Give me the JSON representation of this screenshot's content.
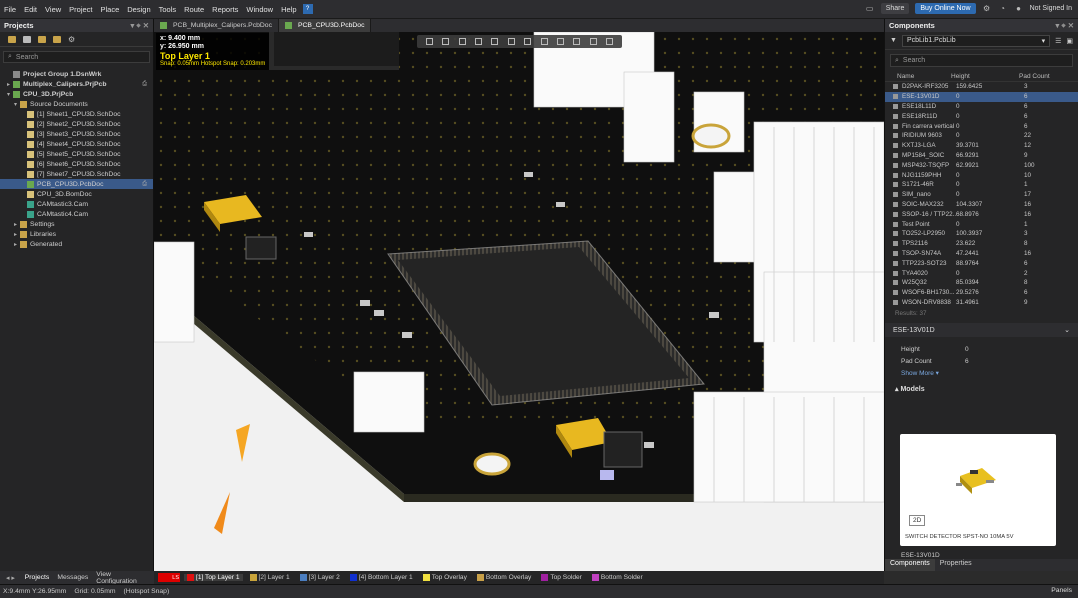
{
  "menu": [
    "File",
    "Edit",
    "View",
    "Project",
    "Place",
    "Design",
    "Tools",
    "Route",
    "Reports",
    "Window",
    "Help"
  ],
  "header": {
    "share": "Share",
    "buy": "Buy Online Now",
    "signin": "Not Signed In"
  },
  "projects": {
    "title": "Projects",
    "search_placeholder": "Search",
    "tree": [
      {
        "label": "Project Group 1.DsnWrk",
        "indent": 1,
        "icon": "grp",
        "bold": true,
        "caret": ""
      },
      {
        "label": "Multiplex_Calipers.PrjPcb",
        "indent": 1,
        "icon": "pcb",
        "bold": true,
        "caret": "▸",
        "badge": "⎙"
      },
      {
        "label": "CPU_3D.PrjPcb",
        "indent": 1,
        "icon": "pcb",
        "bold": true,
        "caret": "▾",
        "selrow": false
      },
      {
        "label": "Source Documents",
        "indent": 2,
        "icon": "folder",
        "caret": "▾"
      },
      {
        "label": "[1] Sheet1_CPU3D.SchDoc",
        "indent": 3,
        "icon": "sch"
      },
      {
        "label": "[2] Sheet2_CPU3D.SchDoc",
        "indent": 3,
        "icon": "sch"
      },
      {
        "label": "[3] Sheet3_CPU3D.SchDoc",
        "indent": 3,
        "icon": "sch"
      },
      {
        "label": "[4] Sheet4_CPU3D.SchDoc",
        "indent": 3,
        "icon": "sch"
      },
      {
        "label": "[5] Sheet5_CPU3D.SchDoc",
        "indent": 3,
        "icon": "sch"
      },
      {
        "label": "[6] Sheet6_CPU3D.SchDoc",
        "indent": 3,
        "icon": "sch"
      },
      {
        "label": "[7] Sheet7_CPU3D.SchDoc",
        "indent": 3,
        "icon": "sch"
      },
      {
        "label": "PCB_CPU3D.PcbDoc",
        "indent": 3,
        "icon": "pcb",
        "sel": true,
        "badge": "⎙"
      },
      {
        "label": "CPU_3D.BomDoc",
        "indent": 3,
        "icon": "sch"
      },
      {
        "label": "CAMtastic3.Cam",
        "indent": 3,
        "icon": "cam"
      },
      {
        "label": "CAMtastic4.Cam",
        "indent": 3,
        "icon": "cam"
      },
      {
        "label": "Settings",
        "indent": 2,
        "icon": "folder",
        "caret": "▸"
      },
      {
        "label": "Libraries",
        "indent": 2,
        "icon": "folder",
        "caret": "▸"
      },
      {
        "label": "Generated",
        "indent": 2,
        "icon": "folder",
        "caret": "▸"
      }
    ]
  },
  "tabs": [
    {
      "label": "PCB_Multiplex_Calipers.PcbDoc",
      "active": false
    },
    {
      "label": "PCB_CPU3D.PcbDoc",
      "active": true
    }
  ],
  "viewport": {
    "x": "x:  9.400  mm",
    "y": "y: 26.950  mm",
    "layer": "Top Layer 1",
    "snap": "Snap: 0.05mm Hotspot Snap: 0.203mm"
  },
  "components": {
    "title": "Components",
    "library": "PcbLib1.PcbLib",
    "search_placeholder": "Search",
    "columns": [
      "Name",
      "Height",
      "Pad Count"
    ],
    "rows": [
      [
        "D2PAK-IRF3205",
        "159.6425",
        "3"
      ],
      [
        "ESE-13V01D",
        "0",
        "6"
      ],
      [
        "ESE18L11D",
        "0",
        "6"
      ],
      [
        "ESE18R11D",
        "0",
        "6"
      ],
      [
        "Fin carrera vertical",
        "0",
        "6"
      ],
      [
        "IRIDIUM 9603",
        "0",
        "22"
      ],
      [
        "KXTJ3-LGA",
        "39.3701",
        "12"
      ],
      [
        "MP1584_SOIC",
        "66.9291",
        "9"
      ],
      [
        "MSP432-TSQFP",
        "62.9921",
        "100"
      ],
      [
        "NJG1159PHH",
        "0",
        "10"
      ],
      [
        "S1721-46R",
        "0",
        "1"
      ],
      [
        "SIM_nano",
        "0",
        "17"
      ],
      [
        "SOIC-MAX232",
        "104.3307",
        "16"
      ],
      [
        "SSOP-16 / TTP22...",
        "68.8976",
        "16"
      ],
      [
        "Test Point",
        "0",
        "1"
      ],
      [
        "TO252-LP2950",
        "100.3937",
        "3"
      ],
      [
        "TPS2116",
        "23.622",
        "8"
      ],
      [
        "TSOP-SN74A",
        "47.2441",
        "16"
      ],
      [
        "TTP223-SOT23",
        "88.9764",
        "6"
      ],
      [
        "TYA4020",
        "0",
        "2"
      ],
      [
        "W25Q32",
        "85.0394",
        "8"
      ],
      [
        "WSOF6-BH1730...",
        "29.5276",
        "6"
      ],
      [
        "WSON-DRV8838",
        "31.4961",
        "9"
      ]
    ],
    "selected_index": 1,
    "results": "Results: 37",
    "detail_title": "ESE-13V01D",
    "props": [
      [
        "Height",
        "0"
      ],
      [
        "Pad Count",
        "6"
      ]
    ],
    "show_more": "Show More ▾",
    "models_label": "Models",
    "model_2d": "2D",
    "model_desc": "SWITCH DETECTOR SPST-NO 10MA 5V",
    "selected_name": "ESE-13V01D",
    "bottom_tabs": [
      "Components",
      "Properties"
    ]
  },
  "bottom_left_tabs": [
    "Projects",
    "Messages",
    "View Configuration"
  ],
  "layers": [
    {
      "label": "[1] Top Layer 1",
      "color": "#e01010",
      "active": true
    },
    {
      "label": "[2] Layer 1",
      "color": "#c9a43a"
    },
    {
      "label": "[3] Layer 2",
      "color": "#4a7dbf"
    },
    {
      "label": "[4] Bottom Layer 1",
      "color": "#1030d0"
    },
    {
      "label": "Top Overlay",
      "color": "#f0e040"
    },
    {
      "label": "Bottom Overlay",
      "color": "#c8a048"
    },
    {
      "label": "Top Solder",
      "color": "#a020a0"
    },
    {
      "label": "Bottom Solder",
      "color": "#c040c0"
    }
  ],
  "ls_label": "LS",
  "status": {
    "xy": "X:9.4mm Y:26.95mm",
    "grid": "Grid: 0.05mm",
    "snap": "(Hotspot Snap)",
    "panels": "Panels"
  }
}
